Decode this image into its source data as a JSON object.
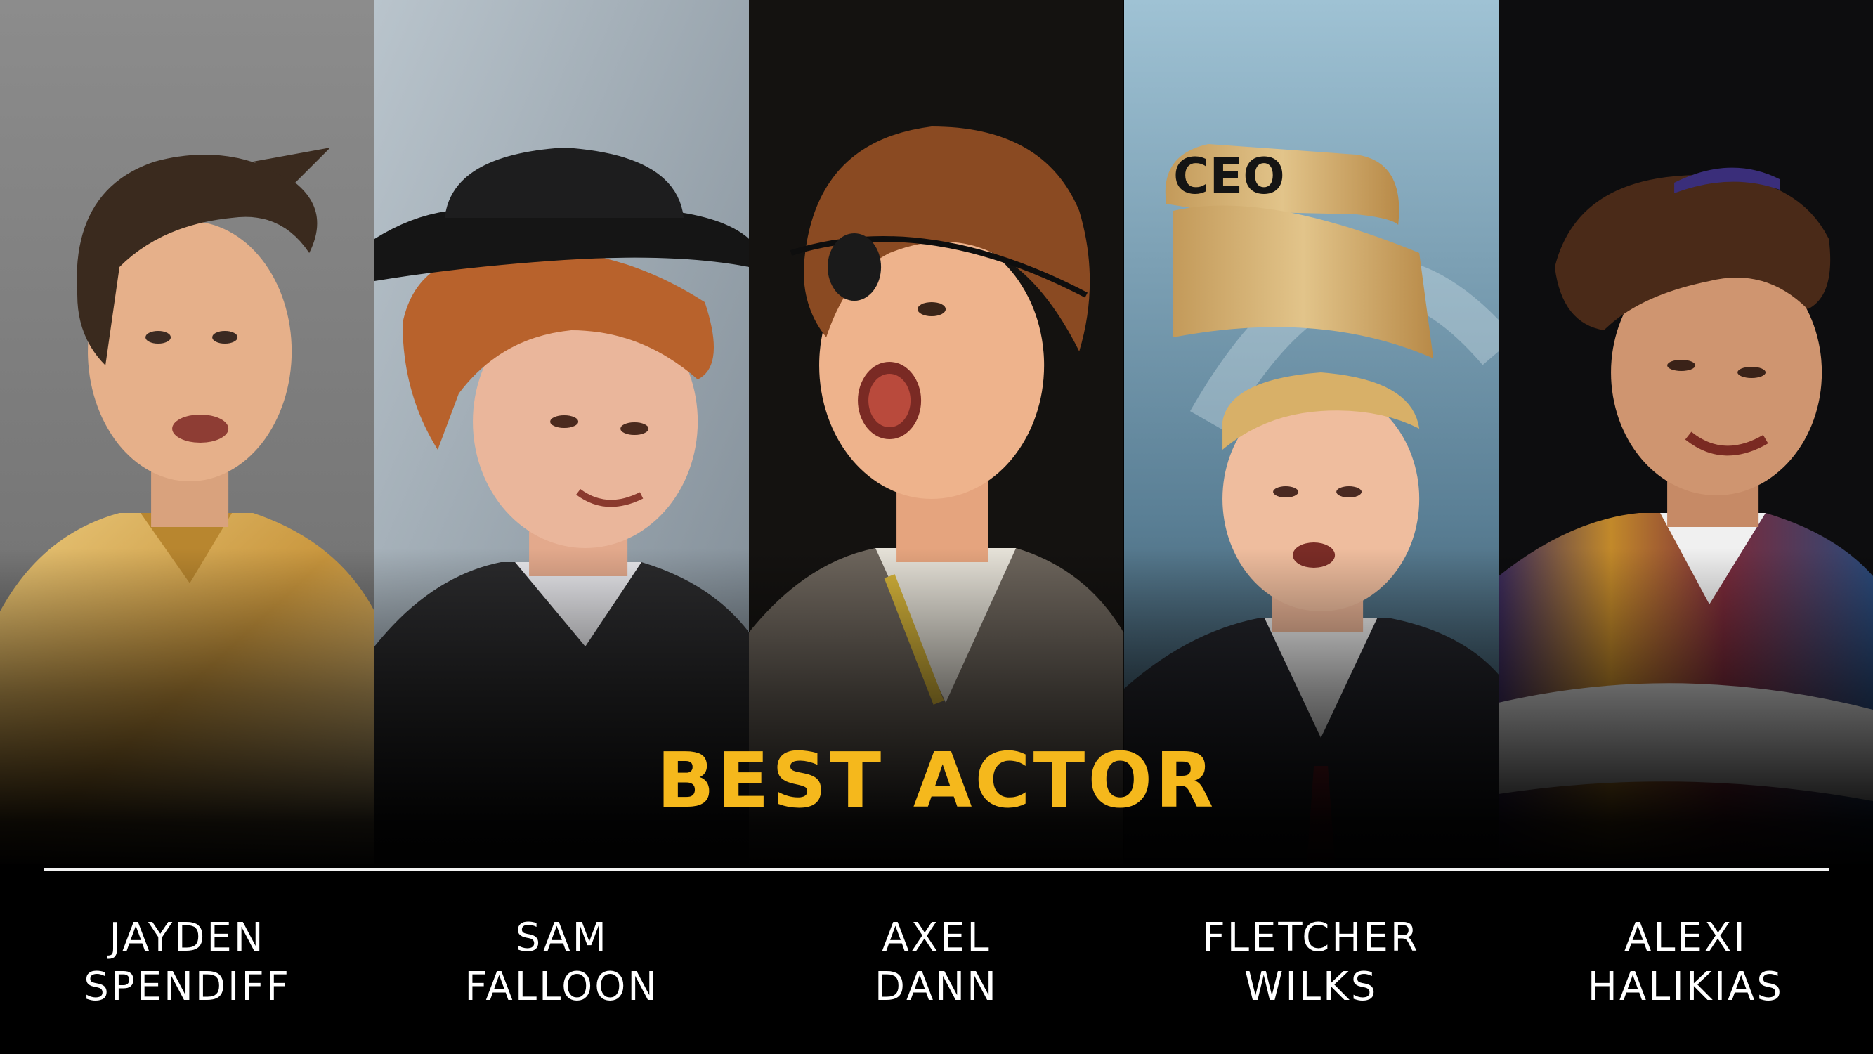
{
  "award": {
    "title": "BEST ACTOR"
  },
  "colors": {
    "accent": "#f5b81c",
    "background": "#000000",
    "text": "#ffffff",
    "rule": "#f2f2f2"
  },
  "nominees": [
    {
      "first": "JAYDEN",
      "last": "SPENDIFF"
    },
    {
      "first": "SAM",
      "last": "FALLOON"
    },
    {
      "first": "AXEL",
      "last": "DANN"
    },
    {
      "first": "FLETCHER",
      "last": "WILKS"
    },
    {
      "first": "ALEXI",
      "last": "HALIKIAS"
    }
  ],
  "props": {
    "hat_sign": "CEO"
  }
}
